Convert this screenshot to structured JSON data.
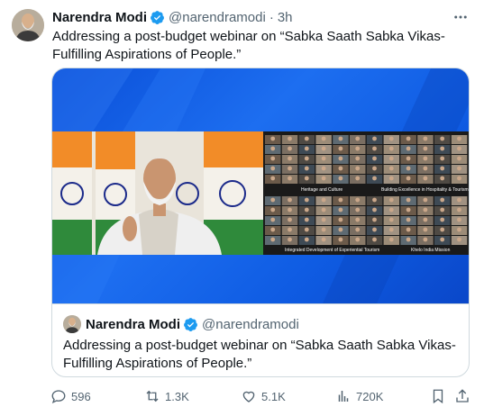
{
  "tweet": {
    "author_name": "Narendra Modi",
    "handle": "@narendramodi",
    "separator": "·",
    "time": "3h",
    "text": "Addressing a post-budget webinar on “Sabka Saath Sabka Vikas-Fulfilling Aspirations of People.”",
    "more_label": "···"
  },
  "media": {
    "panel_labels": [
      "Heritage and Culture",
      "Building Excellence in Hospitality & Tourism",
      "Integrated Development of Experiential Tourism",
      "Khelo India Mission"
    ]
  },
  "quote": {
    "author_name": "Narendra Modi",
    "handle": "@narendramodi",
    "text": "Addressing a post-budget webinar on “Sabka Saath Sabka Vikas-Fulfilling Aspirations of People.”"
  },
  "actions": {
    "replies": "596",
    "reposts": "1.3K",
    "likes": "5.1K",
    "views": "720K"
  },
  "colors": {
    "verified": "#1d9bf0",
    "muted": "#536471",
    "border": "#cfd9de",
    "media_blue": "#1d6ef0"
  },
  "icons": [
    "verified-badge-icon",
    "more-icon",
    "reply-icon",
    "repost-icon",
    "like-icon",
    "views-icon",
    "bookmark-icon",
    "share-icon"
  ]
}
